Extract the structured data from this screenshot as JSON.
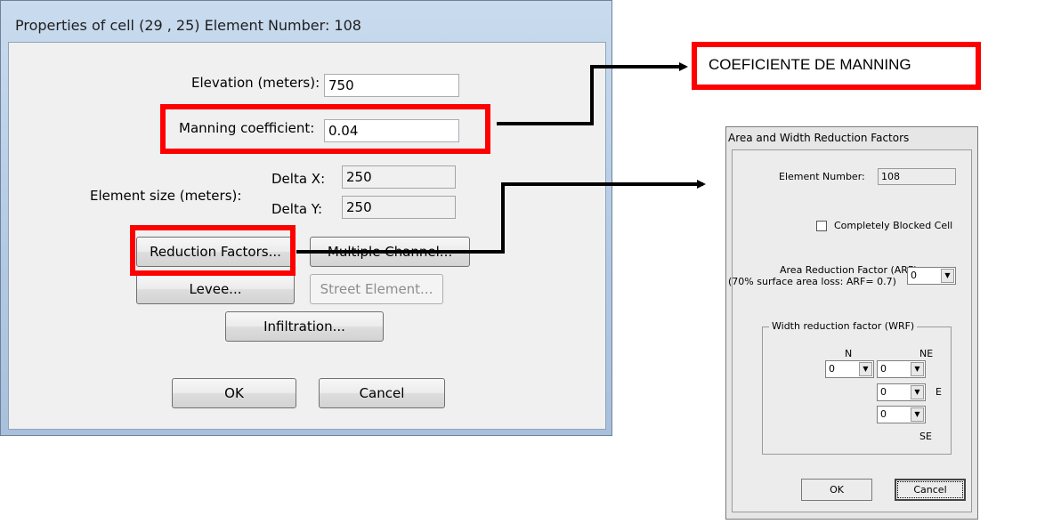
{
  "cell_dialog": {
    "title": "Properties of cell (29 , 25)   Element Number: 108",
    "elevation": {
      "label": "Elevation (meters):",
      "value": "750"
    },
    "manning": {
      "label": "Manning coefficient:",
      "value": "0.04"
    },
    "element_size": {
      "label": "Element size (meters):",
      "delta_x_label": "Delta X:",
      "delta_x_value": "250",
      "delta_y_label": "Delta Y:",
      "delta_y_value": "250"
    },
    "buttons": {
      "reduction_factors": "Reduction Factors...",
      "multiple_channel": "Multiple Channel...",
      "levee": "Levee...",
      "street_element": "Street Element...",
      "infiltration": "Infiltration...",
      "ok": "OK",
      "cancel": "Cancel"
    }
  },
  "annotation": {
    "text": "COEFICIENTE DE MANNING"
  },
  "reduction_dialog": {
    "title": "Area and Width Reduction Factors",
    "element_number_label": "Element Number:",
    "element_number_value": "108",
    "blocked_label": "Completely Blocked Cell",
    "arf_label_1": "Area Reduction Factor (ARF):",
    "arf_label_2": "(70% surface area loss: ARF= 0.7)",
    "arf_value": "0",
    "wrf_group_label": "Width reduction factor (WRF)",
    "dir_n": "N",
    "dir_ne": "NE",
    "dir_e": "E",
    "dir_se": "SE",
    "wrf_n": "0",
    "wrf_ne": "0",
    "wrf_e": "0",
    "wrf_se": "0",
    "ok": "OK",
    "cancel": "Cancel"
  },
  "colors": {
    "highlight": "#ff0000",
    "arrow": "#000000"
  },
  "icons": {
    "dropdown": "chevron-down-icon",
    "arrow": "arrow-right-icon"
  }
}
